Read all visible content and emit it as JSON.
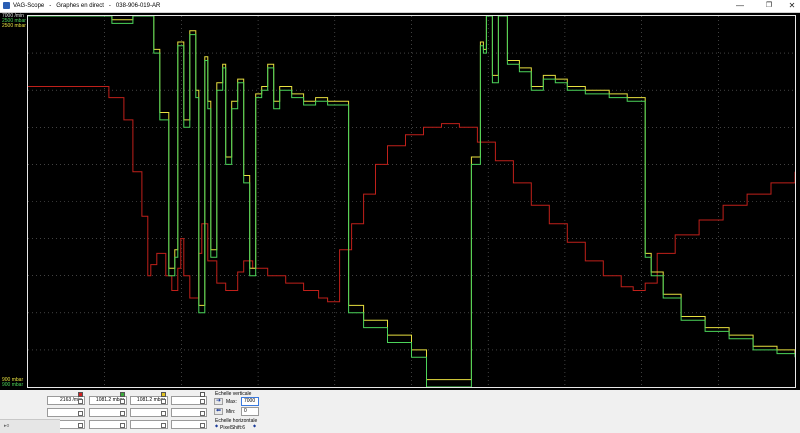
{
  "window": {
    "title": "VAG-Scope   -   Graphes en direct   -   038-906-019-AR",
    "minimize_label": "—",
    "maximize_label": "❐",
    "close_label": "✕"
  },
  "scope": {
    "y_top_labels": {
      "rpm": "7000 /min",
      "green": "2500 mbar",
      "yellow": "2500 mbar"
    },
    "y_bottom_labels": {
      "green": "900 mbar",
      "yellow": "900 mbar"
    },
    "colors": {
      "background": "#000000",
      "grid": "#6a6a6a",
      "rpm_trace": "#c0201a",
      "boost_trace_green": "#4cd45a",
      "boost_trace_yellow": "#e8e040"
    },
    "traces": {
      "rpm": [
        [
          0.0,
          0.81
        ],
        [
          0.04,
          0.81
        ],
        [
          0.12,
          0.81
        ],
        [
          0.135,
          0.78
        ],
        [
          0.16,
          0.72
        ],
        [
          0.175,
          0.58
        ],
        [
          0.19,
          0.46
        ],
        [
          0.2,
          0.3
        ],
        [
          0.205,
          0.33
        ],
        [
          0.215,
          0.36
        ],
        [
          0.23,
          0.3
        ],
        [
          0.24,
          0.26
        ],
        [
          0.25,
          0.32
        ],
        [
          0.255,
          0.4
        ],
        [
          0.26,
          0.3
        ],
        [
          0.27,
          0.24
        ],
        [
          0.285,
          0.36
        ],
        [
          0.29,
          0.44
        ],
        [
          0.3,
          0.34
        ],
        [
          0.315,
          0.28
        ],
        [
          0.33,
          0.26
        ],
        [
          0.35,
          0.31
        ],
        [
          0.36,
          0.34
        ],
        [
          0.375,
          0.32
        ],
        [
          0.4,
          0.3
        ],
        [
          0.43,
          0.28
        ],
        [
          0.46,
          0.26
        ],
        [
          0.485,
          0.24
        ],
        [
          0.5,
          0.23
        ],
        [
          0.52,
          0.37
        ],
        [
          0.54,
          0.44
        ],
        [
          0.56,
          0.52
        ],
        [
          0.58,
          0.6
        ],
        [
          0.6,
          0.65
        ],
        [
          0.63,
          0.68
        ],
        [
          0.66,
          0.7
        ],
        [
          0.69,
          0.71
        ],
        [
          0.72,
          0.7
        ],
        [
          0.75,
          0.66
        ],
        [
          0.78,
          0.61
        ],
        [
          0.81,
          0.55
        ],
        [
          0.84,
          0.49
        ],
        [
          0.87,
          0.44
        ],
        [
          0.9,
          0.39
        ],
        [
          0.93,
          0.34
        ],
        [
          0.96,
          0.3
        ],
        [
          0.99,
          0.27
        ],
        [
          1.01,
          0.26
        ],
        [
          1.03,
          0.28
        ],
        [
          1.05,
          0.36
        ],
        [
          1.08,
          0.41
        ],
        [
          1.12,
          0.45
        ],
        [
          1.16,
          0.49
        ],
        [
          1.2,
          0.52
        ],
        [
          1.24,
          0.55
        ],
        [
          1.28,
          0.58
        ]
      ],
      "green": [
        [
          0.0,
          1.0
        ],
        [
          0.13,
          1.0
        ],
        [
          0.14,
          0.98
        ],
        [
          0.165,
          0.98
        ],
        [
          0.175,
          1.0
        ],
        [
          0.2,
          1.0
        ],
        [
          0.21,
          0.9
        ],
        [
          0.22,
          0.72
        ],
        [
          0.235,
          0.3
        ],
        [
          0.245,
          0.35
        ],
        [
          0.25,
          0.92
        ],
        [
          0.26,
          0.7
        ],
        [
          0.27,
          0.95
        ],
        [
          0.28,
          0.78
        ],
        [
          0.285,
          0.2
        ],
        [
          0.295,
          0.88
        ],
        [
          0.3,
          0.75
        ],
        [
          0.305,
          0.35
        ],
        [
          0.315,
          0.8
        ],
        [
          0.325,
          0.86
        ],
        [
          0.33,
          0.6
        ],
        [
          0.34,
          0.75
        ],
        [
          0.35,
          0.82
        ],
        [
          0.36,
          0.55
        ],
        [
          0.37,
          0.3
        ],
        [
          0.38,
          0.78
        ],
        [
          0.39,
          0.8
        ],
        [
          0.4,
          0.86
        ],
        [
          0.41,
          0.75
        ],
        [
          0.42,
          0.8
        ],
        [
          0.44,
          0.78
        ],
        [
          0.46,
          0.76
        ],
        [
          0.48,
          0.77
        ],
        [
          0.5,
          0.76
        ],
        [
          0.52,
          0.76
        ],
        [
          0.535,
          0.2
        ],
        [
          0.56,
          0.16
        ],
        [
          0.6,
          0.12
        ],
        [
          0.64,
          0.08
        ],
        [
          0.665,
          0.0
        ],
        [
          0.72,
          0.0
        ],
        [
          0.74,
          0.6
        ],
        [
          0.755,
          0.92
        ],
        [
          0.76,
          0.9
        ],
        [
          0.765,
          1.0
        ],
        [
          0.775,
          0.82
        ],
        [
          0.785,
          1.0
        ],
        [
          0.8,
          0.87
        ],
        [
          0.82,
          0.85
        ],
        [
          0.84,
          0.8
        ],
        [
          0.86,
          0.83
        ],
        [
          0.88,
          0.82
        ],
        [
          0.9,
          0.8
        ],
        [
          0.93,
          0.79
        ],
        [
          0.97,
          0.78
        ],
        [
          1.0,
          0.77
        ],
        [
          1.02,
          0.77
        ],
        [
          1.03,
          0.35
        ],
        [
          1.04,
          0.3
        ],
        [
          1.06,
          0.24
        ],
        [
          1.09,
          0.18
        ],
        [
          1.13,
          0.15
        ],
        [
          1.17,
          0.13
        ],
        [
          1.21,
          0.1
        ],
        [
          1.25,
          0.09
        ],
        [
          1.28,
          0.08
        ]
      ],
      "yellow": [
        [
          0.0,
          1.0
        ],
        [
          0.13,
          1.0
        ],
        [
          0.14,
          0.99
        ],
        [
          0.165,
          0.99
        ],
        [
          0.175,
          1.0
        ],
        [
          0.2,
          1.0
        ],
        [
          0.21,
          0.91
        ],
        [
          0.22,
          0.74
        ],
        [
          0.235,
          0.32
        ],
        [
          0.245,
          0.37
        ],
        [
          0.25,
          0.93
        ],
        [
          0.26,
          0.72
        ],
        [
          0.27,
          0.96
        ],
        [
          0.28,
          0.8
        ],
        [
          0.285,
          0.22
        ],
        [
          0.295,
          0.89
        ],
        [
          0.3,
          0.77
        ],
        [
          0.305,
          0.37
        ],
        [
          0.315,
          0.82
        ],
        [
          0.325,
          0.87
        ],
        [
          0.33,
          0.62
        ],
        [
          0.34,
          0.77
        ],
        [
          0.35,
          0.83
        ],
        [
          0.36,
          0.57
        ],
        [
          0.37,
          0.32
        ],
        [
          0.38,
          0.79
        ],
        [
          0.39,
          0.81
        ],
        [
          0.4,
          0.87
        ],
        [
          0.41,
          0.77
        ],
        [
          0.42,
          0.81
        ],
        [
          0.44,
          0.79
        ],
        [
          0.46,
          0.77
        ],
        [
          0.48,
          0.78
        ],
        [
          0.5,
          0.77
        ],
        [
          0.52,
          0.77
        ],
        [
          0.535,
          0.22
        ],
        [
          0.56,
          0.18
        ],
        [
          0.6,
          0.14
        ],
        [
          0.64,
          0.1
        ],
        [
          0.665,
          0.02
        ],
        [
          0.72,
          0.02
        ],
        [
          0.74,
          0.62
        ],
        [
          0.755,
          0.93
        ],
        [
          0.76,
          0.91
        ],
        [
          0.765,
          1.0
        ],
        [
          0.775,
          0.84
        ],
        [
          0.785,
          1.0
        ],
        [
          0.8,
          0.88
        ],
        [
          0.82,
          0.86
        ],
        [
          0.84,
          0.81
        ],
        [
          0.86,
          0.84
        ],
        [
          0.88,
          0.83
        ],
        [
          0.9,
          0.81
        ],
        [
          0.93,
          0.8
        ],
        [
          0.97,
          0.79
        ],
        [
          1.0,
          0.78
        ],
        [
          1.02,
          0.78
        ],
        [
          1.03,
          0.36
        ],
        [
          1.04,
          0.31
        ],
        [
          1.06,
          0.25
        ],
        [
          1.09,
          0.19
        ],
        [
          1.13,
          0.16
        ],
        [
          1.17,
          0.14
        ],
        [
          1.21,
          0.11
        ],
        [
          1.25,
          0.1
        ],
        [
          1.28,
          0.09
        ]
      ]
    }
  },
  "channels": [
    {
      "value": "2163 /min",
      "color": "#d32020",
      "checked": true
    },
    {
      "value": "1081.2 mbar",
      "color": "#3aa83a",
      "checked": true
    },
    {
      "value": "1081.2 mbar",
      "color": "#e0c020",
      "checked": true
    },
    {
      "value": "",
      "color": "#ffffff",
      "checked": false
    }
  ],
  "vertical_scale": {
    "label": "Echelle verticale",
    "max_label": "Max:",
    "max_value": "7000",
    "min_label": "Min:",
    "min_value": "0"
  },
  "horizontal_scale": {
    "label": "Echelle horizontale",
    "pixelshift_value": "PixelShift:6"
  },
  "footer": {
    "status_text": "▸o"
  }
}
